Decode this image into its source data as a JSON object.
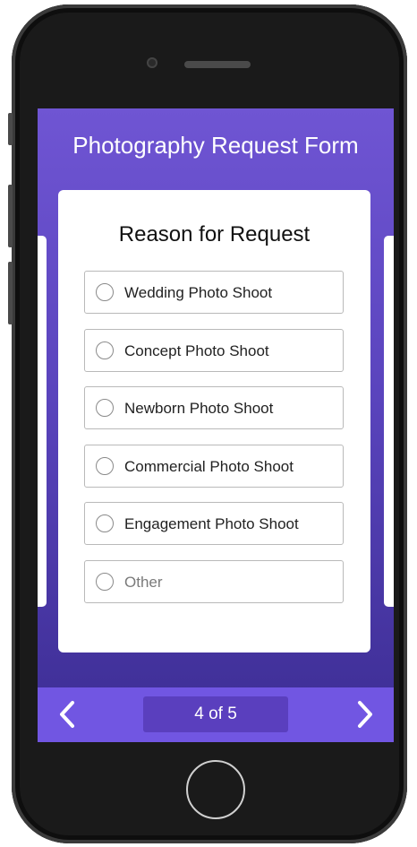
{
  "header": {
    "title": "Photography Request Form"
  },
  "card": {
    "title": "Reason for Request",
    "options": [
      {
        "label": "Wedding Photo Shoot"
      },
      {
        "label": "Concept Photo Shoot"
      },
      {
        "label": "Newborn Photo Shoot"
      },
      {
        "label": "Commercial Photo Shoot"
      },
      {
        "label": "Engagement Photo Shoot"
      },
      {
        "label": "Other"
      }
    ]
  },
  "footer": {
    "current_page": "4",
    "page_separator": "of",
    "total_pages": "5",
    "prev_icon": "chevron-left-icon",
    "next_icon": "chevron-right-icon"
  },
  "colors": {
    "screen_top": "#6f55d3",
    "screen_bottom": "#3c2d93",
    "footer": "#7156e2",
    "pager": "#5a3fbe"
  }
}
